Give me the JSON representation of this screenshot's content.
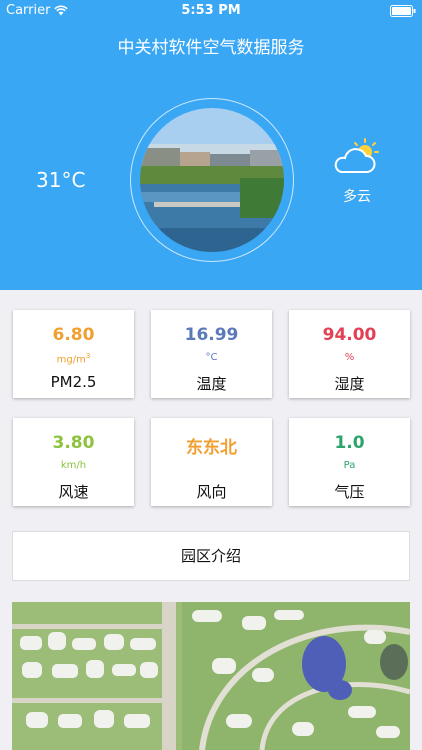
{
  "status_bar": {
    "carrier": "Carrier",
    "time": "5:53 PM"
  },
  "app_title": "中关村软件空气数据服务",
  "weather": {
    "temperature": "31°C",
    "condition": "多云",
    "icon": "partly-cloudy-icon"
  },
  "metrics": [
    {
      "value": "6.80",
      "unit": "mg/m",
      "unit_sup": "3",
      "name": "PM2.5",
      "color": "#f0a030"
    },
    {
      "value": "16.99",
      "unit": "°C",
      "name": "温度",
      "color": "#5b79b8"
    },
    {
      "value": "94.00",
      "unit": "%",
      "name": "湿度",
      "color": "#e14055"
    },
    {
      "value": "3.80",
      "unit": "km/h",
      "name": "风速",
      "color": "#8cc23d"
    },
    {
      "value": "东东北",
      "unit": "",
      "name": "风向",
      "color": "#f0a030"
    },
    {
      "value": "1.0",
      "unit": "Pa",
      "name": "气压",
      "color": "#2ea46d"
    }
  ],
  "park_button": {
    "label": "园区介绍"
  },
  "colors": {
    "header_bg": "#3aa7f5",
    "page_bg": "#efeff4"
  }
}
